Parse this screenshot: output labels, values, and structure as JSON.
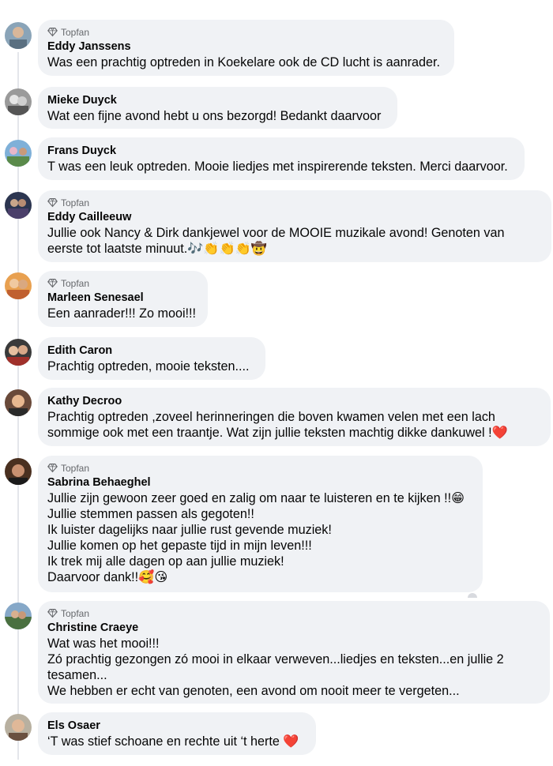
{
  "badge_label": "Topfan",
  "comments": [
    {
      "author": "Eddy Janssens",
      "topfan": true,
      "text": "Was een prachtig optreden in Koekelare ook de CD lucht is aanrader.",
      "avatar": "avatar-photo-1"
    },
    {
      "author": "Mieke Duyck",
      "topfan": false,
      "text": "Wat een fijne avond hebt u ons bezorgd! Bedankt daarvoor",
      "avatar": "avatar-photo-2"
    },
    {
      "author": "Frans Duyck",
      "topfan": false,
      "text": "T was een leuk optreden. Mooie liedjes met inspirerende teksten. Merci daarvoor.",
      "avatar": "avatar-photo-3"
    },
    {
      "author": "Eddy Cailleeuw",
      "topfan": true,
      "text": "Jullie ook Nancy & Dirk dankjewel voor de MOOIE muzikale avond! Genoten van\neerste tot laatste minuut.🎶👏👏👏🤠",
      "avatar": "avatar-photo-4"
    },
    {
      "author": "Marleen Senesael",
      "topfan": true,
      "text": "Een aanrader!!! Zo mooi!!!",
      "avatar": "avatar-photo-5"
    },
    {
      "author": "Edith Caron",
      "topfan": false,
      "text": "Prachtig optreden, mooie teksten....",
      "avatar": "avatar-photo-6"
    },
    {
      "author": "Kathy Decroo",
      "topfan": false,
      "text": "Prachtig optreden ,zoveel herinneringen die boven kwamen velen met een lach\nsommige ook met een traantje. Wat zijn jullie teksten machtig dikke dankuwel !❤️",
      "avatar": "avatar-photo-7"
    },
    {
      "author": "Sabrina Behaeghel",
      "topfan": true,
      "text": "Jullie zijn gewoon zeer goed en zalig om naar te luisteren en te kijken !!😁\nJullie stemmen passen als gegoten!!\nIk luister dagelijks naar jullie rust gevende muziek!\nJullie komen op het gepaste tijd in mijn leven!!!\nIk trek mij alle dagen op aan jullie muziek!\nDaarvoor dank!!🥰😘",
      "avatar": "avatar-photo-8"
    },
    {
      "author": "Christine Craeye",
      "topfan": true,
      "text": "Wat was het mooi!!!\nZó prachtig gezongen zó mooi in elkaar verweven...liedjes en teksten...en jullie 2\ntesamen...\nWe hebben er echt van genoten, een avond om nooit meer te vergeten...",
      "avatar": "avatar-photo-9"
    },
    {
      "author": "Els Osaer",
      "topfan": false,
      "text": "‘T was stief schoane en rechte uit ‘t herte ❤️",
      "avatar": "avatar-photo-10"
    }
  ]
}
